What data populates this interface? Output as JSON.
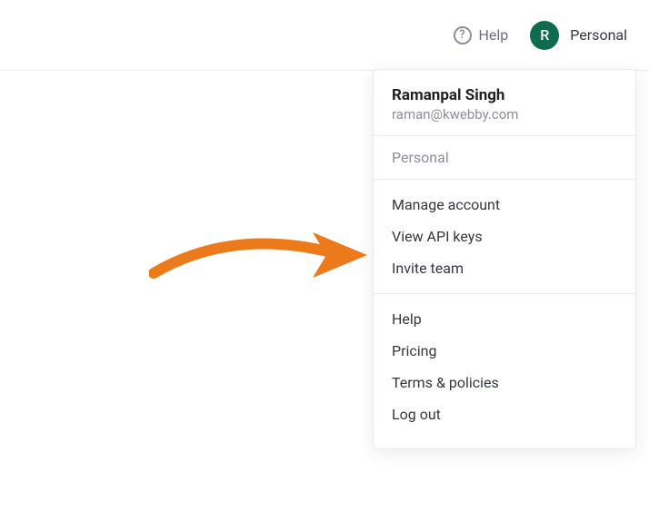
{
  "header": {
    "help_label": "Help",
    "account_label": "Personal",
    "avatar_initial": "R"
  },
  "dropdown": {
    "user_name": "Ramanpal Singh",
    "user_email": "raman@kwebby.com",
    "org_label": "Personal",
    "group1": {
      "manage_account": "Manage account",
      "view_api_keys": "View API keys",
      "invite_team": "Invite team"
    },
    "group2": {
      "help": "Help",
      "pricing": "Pricing",
      "terms": "Terms & policies",
      "logout": "Log out"
    }
  }
}
